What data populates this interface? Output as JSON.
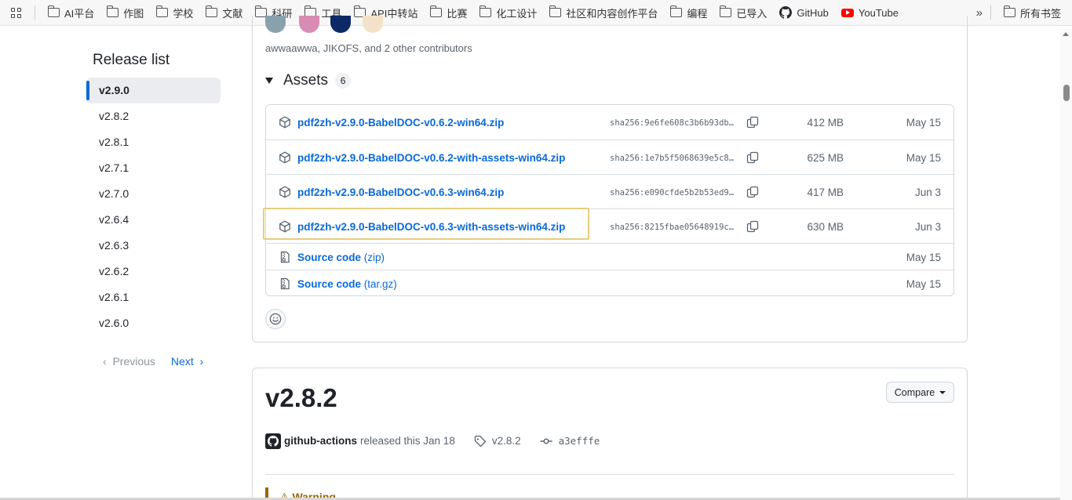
{
  "bookmarks": {
    "items": [
      "AI平台",
      "作图",
      "学校",
      "文献",
      "科研",
      "工具",
      "API中转站",
      "比赛",
      "化工设计",
      "社区和内容创作平台",
      "编程",
      "已导入"
    ],
    "github": "GitHub",
    "youtube": "YouTube",
    "more": "»",
    "all": "所有书签"
  },
  "sidebar": {
    "title": "Release list",
    "releases": [
      "v2.9.0",
      "v2.8.2",
      "v2.8.1",
      "v2.7.1",
      "v2.7.0",
      "v2.6.4",
      "v2.6.3",
      "v2.6.2",
      "v2.6.1",
      "v2.6.0"
    ],
    "active": "v2.9.0",
    "previous": "Previous",
    "next": "Next"
  },
  "release": {
    "contributors": "awwaawwa, JIKOFS, and 2 other contributors",
    "assets_title": "Assets",
    "assets_count": "6",
    "assets": [
      {
        "name": "pdf2zh-v2.9.0-BabelDOC-v0.6.2-win64.zip",
        "sha": "sha256:9e6fe608c3b6b93db…",
        "size": "412 MB",
        "date": "May 15"
      },
      {
        "name": "pdf2zh-v2.9.0-BabelDOC-v0.6.2-with-assets-win64.zip",
        "sha": "sha256:1e7b5f5068639e5c8…",
        "size": "625 MB",
        "date": "May 15"
      },
      {
        "name": "pdf2zh-v2.9.0-BabelDOC-v0.6.3-win64.zip",
        "sha": "sha256:e090cfde5b2b53ed9…",
        "size": "417 MB",
        "date": "Jun 3"
      },
      {
        "name": "pdf2zh-v2.9.0-BabelDOC-v0.6.3-with-assets-win64.zip",
        "sha": "sha256:8215fbae05648919c…",
        "size": "630 MB",
        "date": "Jun 3"
      }
    ],
    "sources": [
      {
        "label": "Source code",
        "ext": "(zip)",
        "date": "May 15"
      },
      {
        "label": "Source code",
        "ext": "(tar.gz)",
        "date": "May 15"
      }
    ]
  },
  "next_release": {
    "title": "v2.8.2",
    "compare": "Compare",
    "author": "github-actions",
    "released": "released this Jan 18",
    "tag": "v2.8.2",
    "commit": "a3efffe",
    "warning": "Warning"
  },
  "colors": {
    "link": "#0969da",
    "highlight_border": "#e8cd7e",
    "warning": "#9a6700"
  }
}
